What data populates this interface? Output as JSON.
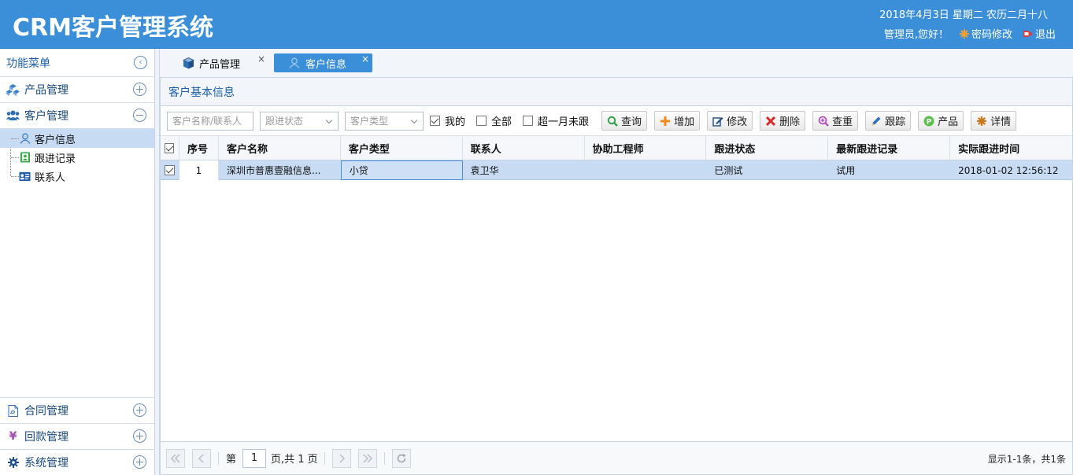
{
  "header": {
    "title": "CRM客户管理系统",
    "date": "2018年4月3日 星期二 农历二月十八",
    "greeting": "管理员,您好！",
    "change_password": "密码修改",
    "logout": "退出"
  },
  "sidebar": {
    "title": "功能菜单",
    "groups": [
      {
        "label": "产品管理",
        "icon": "cubes-icon",
        "state": "collapsed"
      },
      {
        "label": "客户管理",
        "icon": "users-icon",
        "state": "expanded"
      }
    ],
    "tree": [
      {
        "label": "客户信息",
        "icon": "user-icon",
        "selected": true
      },
      {
        "label": "跟进记录",
        "icon": "contact-book-icon"
      },
      {
        "label": "联系人",
        "icon": "id-card-icon"
      }
    ],
    "bottom_groups": [
      {
        "label": "合同管理",
        "icon": "pdf-file-icon"
      },
      {
        "label": "回款管理",
        "icon": "yen-icon",
        "symbol": "¥"
      },
      {
        "label": "系统管理",
        "icon": "gear-icon"
      }
    ]
  },
  "tabs": [
    {
      "label": "产品管理",
      "close": "×"
    },
    {
      "label": "客户信息",
      "close": "×",
      "active": true
    }
  ],
  "panel": {
    "title": "客户基本信息"
  },
  "toolbar": {
    "name_placeholder": "客户名称/联系人",
    "status_placeholder": "跟进状态",
    "type_placeholder": "客户类型",
    "mine_label": "我的",
    "all_label": "全部",
    "overdue_label": "超一月未跟",
    "buttons": {
      "query": "查询",
      "add": "增加",
      "edit": "修改",
      "delete": "删除",
      "reset": "查重",
      "follow": "跟踪",
      "product": "产品",
      "detail": "详情"
    }
  },
  "grid": {
    "columns": [
      "序号",
      "客户名称",
      "客户类型",
      "联系人",
      "协助工程师",
      "跟进状态",
      "最新跟进记录",
      "实际跟进时间"
    ],
    "rows": [
      {
        "no": "1",
        "name": "深圳市普惠壹融信息...",
        "type": "小贷",
        "contact": "袁卫华",
        "engineer": "",
        "status": "已测试",
        "latest": "试用",
        "time": "2018-01-02 12:56:12"
      }
    ]
  },
  "pager": {
    "page_prefix": "第",
    "page_value": "1",
    "page_suffix": "页,共 1 页",
    "info": "显示1-1条，共1条"
  },
  "colors": {
    "header_bg": "#3b8fd8",
    "selected_row": "#c7dcf2",
    "title_blue": "#1a5ea8"
  }
}
